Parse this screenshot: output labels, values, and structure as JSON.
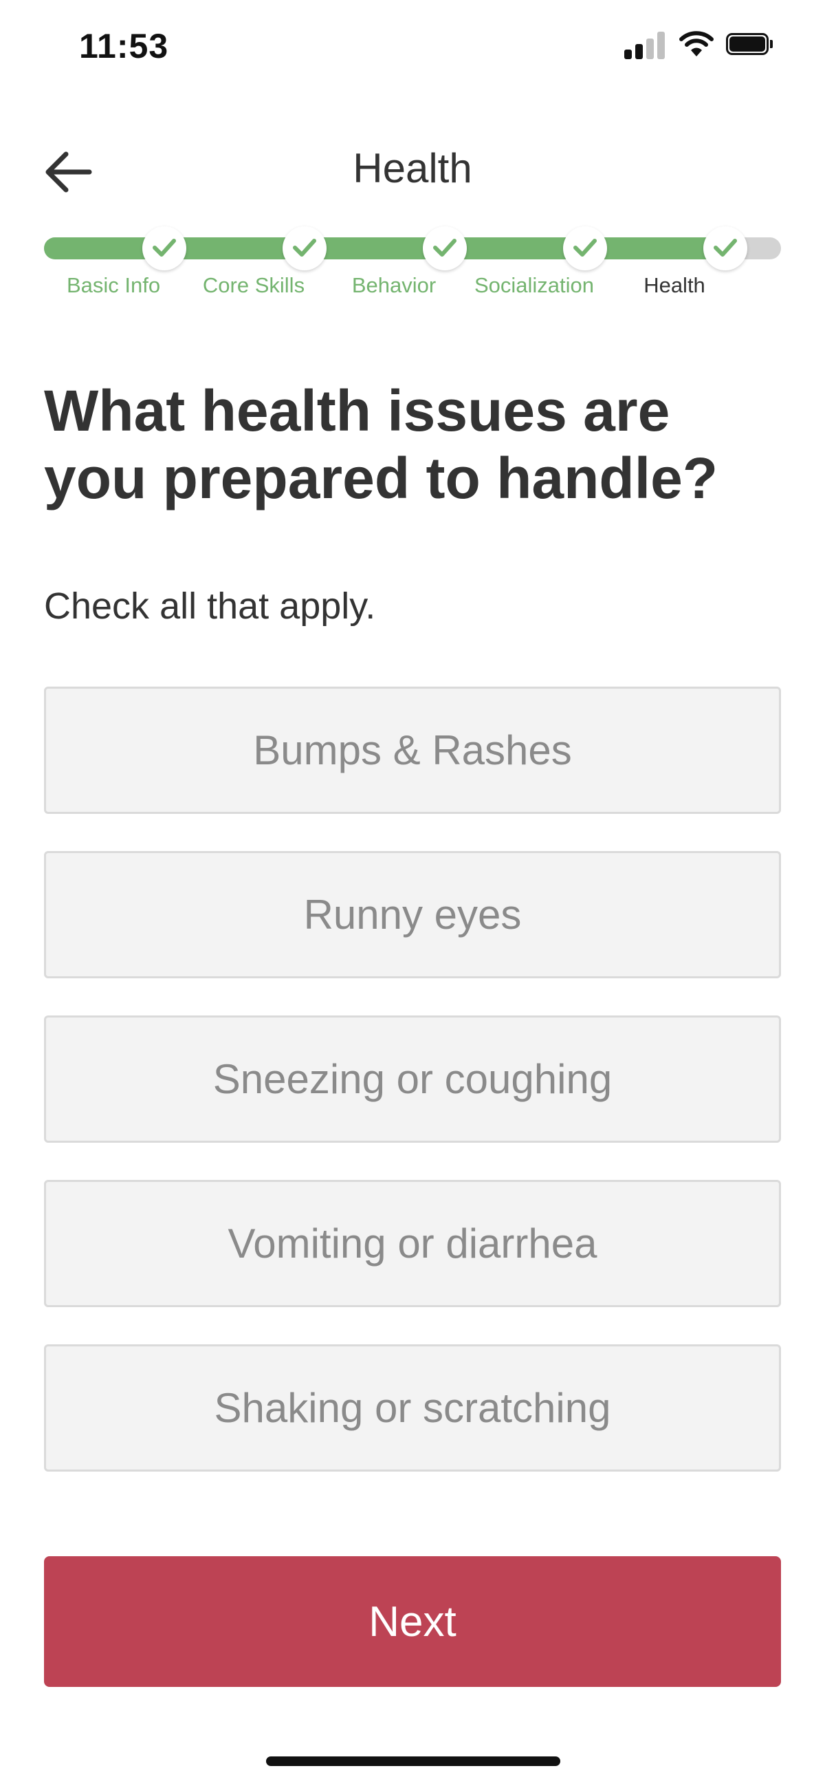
{
  "status_bar": {
    "time": "11:53",
    "icons": [
      "cellular-signal-icon",
      "wifi-icon",
      "battery-icon"
    ]
  },
  "header": {
    "title": "Health",
    "back_icon": "arrow-left-icon"
  },
  "progress": {
    "steps": [
      {
        "label": "Basic Info",
        "completed": true
      },
      {
        "label": "Core Skills",
        "completed": true
      },
      {
        "label": "Behavior",
        "completed": true
      },
      {
        "label": "Socialization",
        "completed": true
      },
      {
        "label": "Health",
        "completed": true,
        "current": true
      }
    ],
    "colors": {
      "complete": "#74b46f",
      "incomplete": "#d3d3d3",
      "current_label": "#333333"
    }
  },
  "question": {
    "title": "What health issues are you prepared to handle?",
    "instruction": "Check all that apply."
  },
  "options": [
    {
      "label": "Bumps & Rashes",
      "selected": false
    },
    {
      "label": "Runny eyes",
      "selected": false
    },
    {
      "label": "Sneezing or coughing",
      "selected": false
    },
    {
      "label": "Vomiting or diarrhea",
      "selected": false
    },
    {
      "label": "Shaking or scratching",
      "selected": false
    }
  ],
  "footer": {
    "next_label": "Next",
    "next_color": "#bd4354"
  }
}
